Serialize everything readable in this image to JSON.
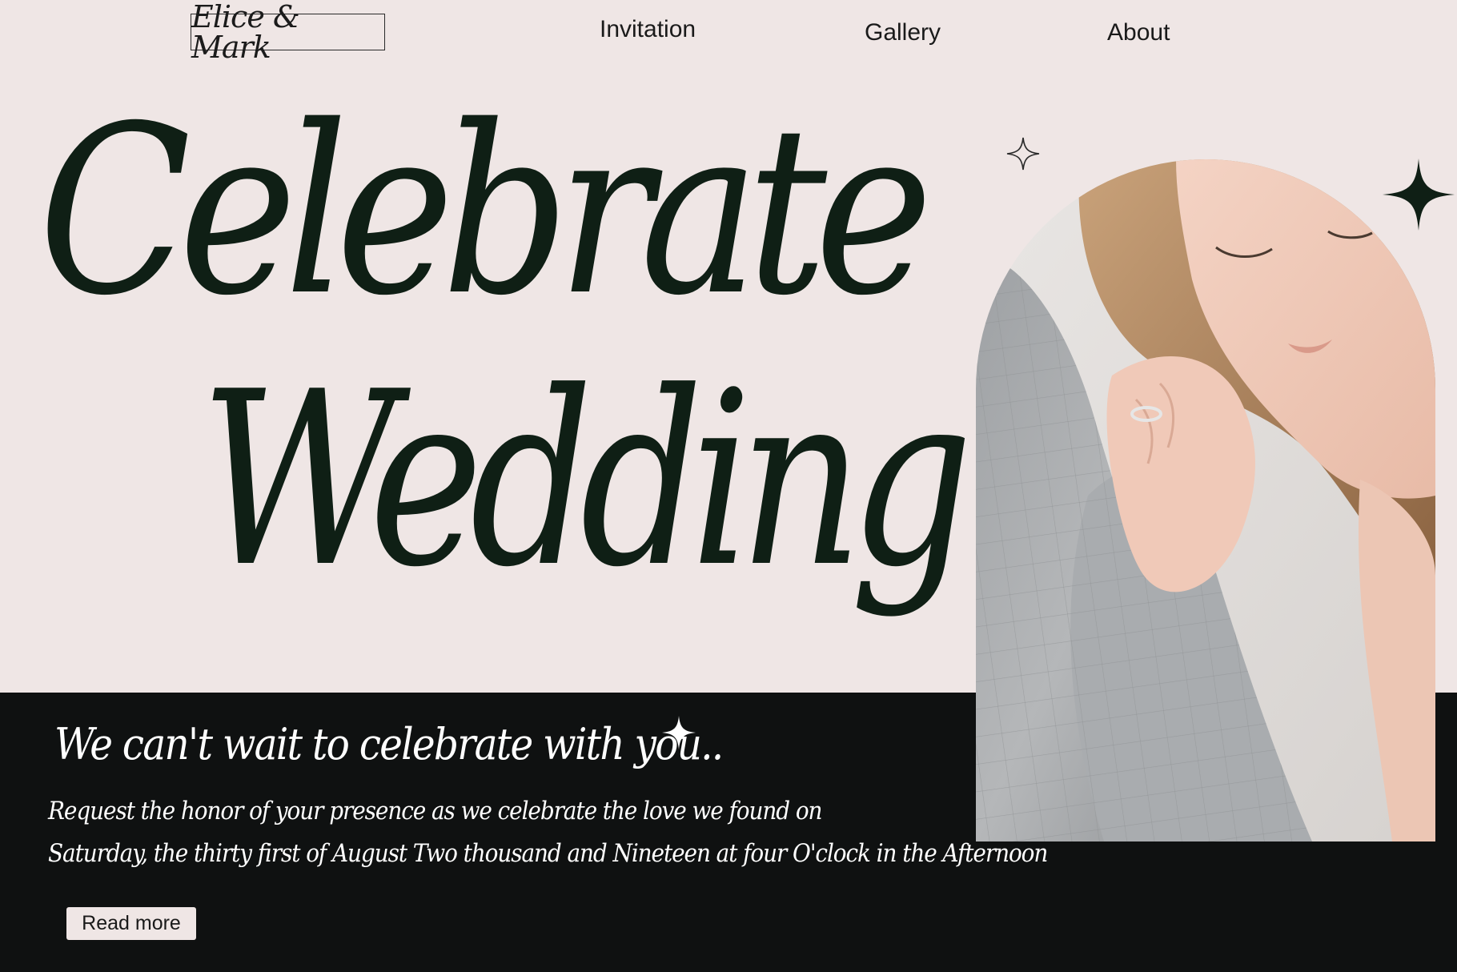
{
  "header": {
    "logo": "Elice & Mark",
    "nav": [
      "Invitation",
      "Gallery",
      "About"
    ]
  },
  "hero": {
    "line1": "Celebrate",
    "line2": "Wedding"
  },
  "band": {
    "tagline": "We can't wait to celebrate with you..",
    "line1": "Request the honor of your presence as we celebrate the love we found on",
    "line2": "Saturday, the thirty first of August Two thousand and Nineteen at four O'clock in the Afternoon",
    "button": "Read more"
  },
  "colors": {
    "background": "#efe6e5",
    "ink": "#0f1f15",
    "band": "#0f1111"
  }
}
